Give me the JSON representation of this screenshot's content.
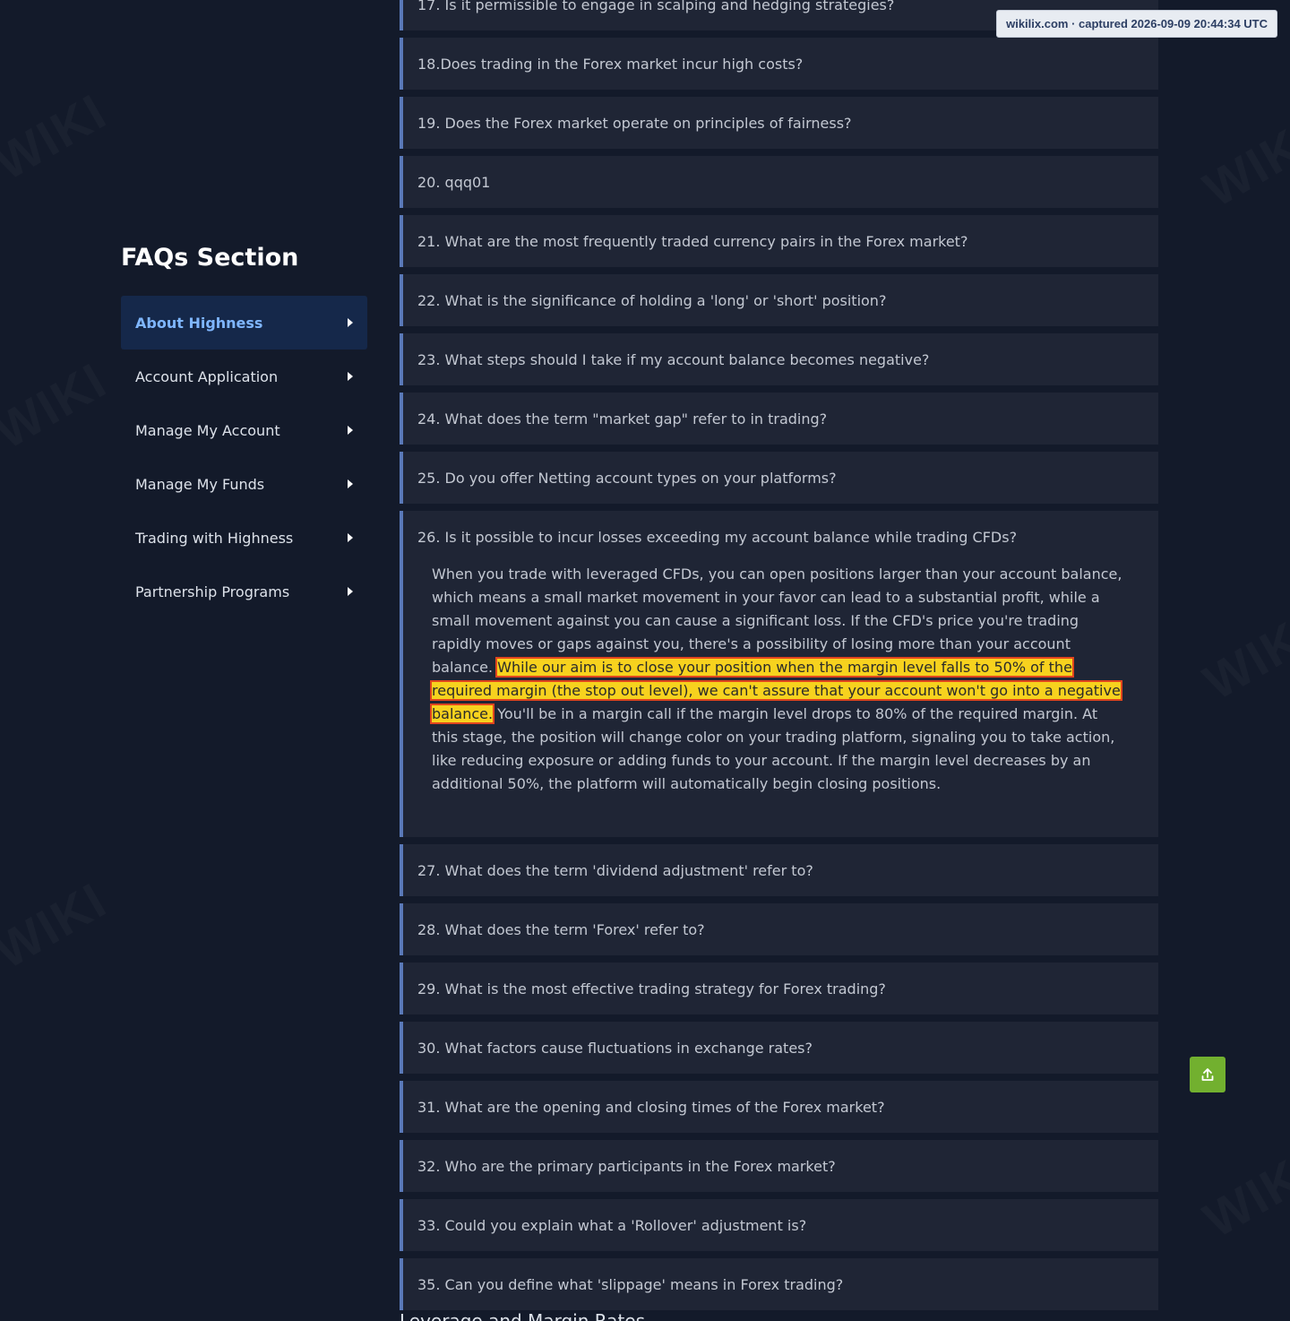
{
  "stamp": "wikilix.com · captured 2026-09-09 20:44:34 UTC",
  "sidebar": {
    "title": "FAQs Section",
    "items": [
      {
        "label": "About Highness",
        "active": true
      },
      {
        "label": "Account Application"
      },
      {
        "label": "Manage My Account"
      },
      {
        "label": "Manage My Funds"
      },
      {
        "label": "Trading with Highness"
      },
      {
        "label": "Partnership Programs"
      }
    ]
  },
  "faq": {
    "items": [
      {
        "q": "17. Is it permissible to engage in scalping and hedging strategies?"
      },
      {
        "q": "18.Does trading in the Forex market incur high costs?"
      },
      {
        "q": "19. Does the Forex market operate on principles of fairness?"
      },
      {
        "q": "20. qqq01"
      },
      {
        "q": "21. What are the most frequently traded currency pairs in the Forex market?"
      },
      {
        "q": "22. What is the significance of holding a 'long' or 'short' position?"
      },
      {
        "q": "23. What steps should I take if my account balance becomes negative?"
      },
      {
        "q": "24. What does the term \"market gap\" refer to in trading?"
      },
      {
        "q": "25. Do you offer Netting account types on your platforms?"
      },
      {
        "q": "26. Is it possible to incur losses exceeding my account balance while trading CFDs?",
        "a_before": "When you trade with leveraged CFDs, you can open positions larger than your account balance, which means a small market movement in your favor can lead to a substantial profit, while a small movement against you can cause a significant loss. If the CFD's price you're trading rapidly moves or gaps against you, there's a possibility of losing more than your account balance.",
        "a_highlight": "While our aim is to close your position when the margin level falls to 50% of the required margin (the stop out level), we can't assure that your account won't go into a negative balance.",
        "a_after": "You'll be in a margin call if the margin level drops to 80% of the required margin. At this stage, the position will change color on your trading platform, signaling you to take action, like reducing exposure or adding funds to your account. If the margin level decreases by an additional 50%, the platform will automatically begin closing positions."
      },
      {
        "q": "27. What does the term 'dividend adjustment' refer to?"
      },
      {
        "q": "28. What does the term 'Forex' refer to?"
      },
      {
        "q": "29. What is the most effective trading strategy for Forex trading?"
      },
      {
        "q": "30. What factors cause fluctuations in exchange rates?"
      },
      {
        "q": "31. What are the opening and closing times of the Forex market?"
      },
      {
        "q": "32. Who are the primary participants in the Forex market?"
      },
      {
        "q": "33. Could you explain what a 'Rollover' adjustment is?"
      },
      {
        "q": "35. Can you define what 'slippage' means in Forex trading?"
      }
    ]
  },
  "next_section_peek": "Leverage and Margin Rates",
  "icons": {
    "scroll_top": "upload-arrow-icon",
    "caret": "caret-right-icon"
  },
  "colors": {
    "background": "#131a2a",
    "card": "#1f2535",
    "accent_border": "#5a79b8",
    "active_item": "#15284a",
    "active_text": "#7fb6ff",
    "highlight": "#f7d21e",
    "button": "#72b02f"
  }
}
